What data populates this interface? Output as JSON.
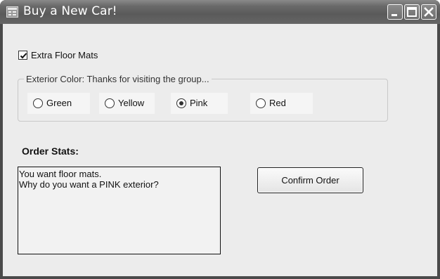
{
  "window": {
    "title": "Buy a New Car!",
    "icon": "form-icon",
    "controls": [
      "minimize-icon",
      "maximize-icon",
      "close-icon"
    ]
  },
  "options": {
    "floor_mats": {
      "label": "Extra Floor Mats",
      "checked": true
    }
  },
  "exterior_color": {
    "legend": "Exterior Color: Thanks for visiting the group...",
    "options": [
      {
        "label": "Green",
        "selected": false
      },
      {
        "label": "Yellow",
        "selected": false
      },
      {
        "label": "Pink",
        "selected": true
      },
      {
        "label": "Red",
        "selected": false
      }
    ]
  },
  "order_stats": {
    "heading": "Order Stats:",
    "lines": [
      "You want floor mats.",
      "Why do you want a PINK exterior?"
    ]
  },
  "actions": {
    "confirm_label": "Confirm Order"
  }
}
